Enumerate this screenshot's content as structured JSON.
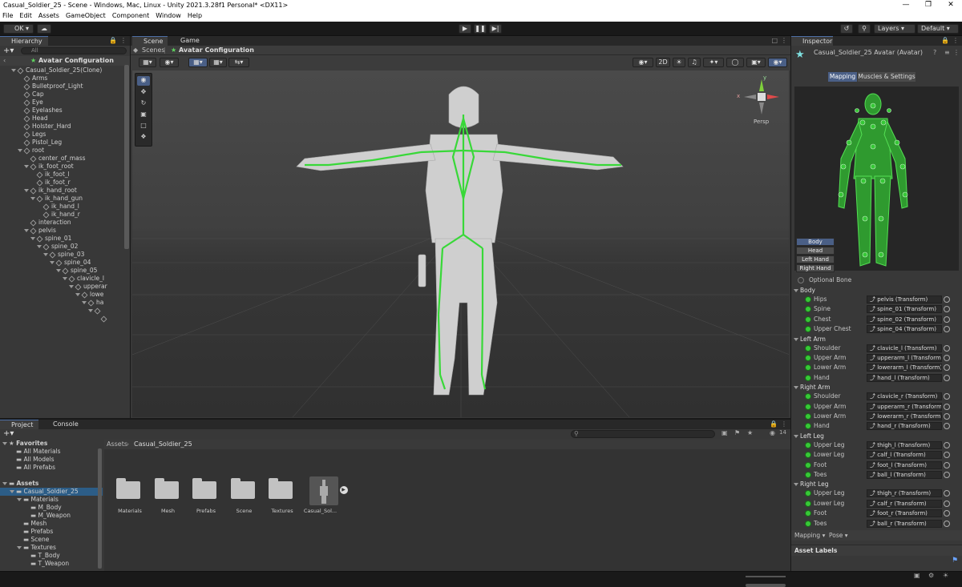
{
  "window": {
    "title": "Casual_Soldier_25 - Scene - Windows, Mac, Linux - Unity 2021.3.28f1 Personal* <DX11>"
  },
  "menu": [
    "File",
    "Edit",
    "Assets",
    "GameObject",
    "Component",
    "Window",
    "Help"
  ],
  "toolbar": {
    "account": "OK",
    "layers": "Layers",
    "layout": "Default"
  },
  "hierarchy": {
    "tab": "Hierarchy",
    "search_placeholder": "All",
    "header": "Avatar Configuration",
    "items": [
      {
        "label": "Casual_Soldier_25(Clone)",
        "depth": 1,
        "exp": true
      },
      {
        "label": "Arms",
        "depth": 2
      },
      {
        "label": "Bulletproof_Light",
        "depth": 2
      },
      {
        "label": "Cap",
        "depth": 2
      },
      {
        "label": "Eye",
        "depth": 2
      },
      {
        "label": "Eyelashes",
        "depth": 2
      },
      {
        "label": "Head",
        "depth": 2
      },
      {
        "label": "Holster_Hard",
        "depth": 2
      },
      {
        "label": "Legs",
        "depth": 2
      },
      {
        "label": "Pistol_Leg",
        "depth": 2
      },
      {
        "label": "root",
        "depth": 2,
        "exp": true
      },
      {
        "label": "center_of_mass",
        "depth": 3
      },
      {
        "label": "ik_foot_root",
        "depth": 3,
        "exp": true
      },
      {
        "label": "ik_foot_l",
        "depth": 4
      },
      {
        "label": "ik_foot_r",
        "depth": 4
      },
      {
        "label": "ik_hand_root",
        "depth": 3,
        "exp": true
      },
      {
        "label": "ik_hand_gun",
        "depth": 4,
        "exp": true
      },
      {
        "label": "ik_hand_l",
        "depth": 5
      },
      {
        "label": "ik_hand_r",
        "depth": 5
      },
      {
        "label": "interaction",
        "depth": 3
      },
      {
        "label": "pelvis",
        "depth": 3,
        "exp": true
      },
      {
        "label": "spine_01",
        "depth": 4,
        "exp": true
      },
      {
        "label": "spine_02",
        "depth": 5,
        "exp": true
      },
      {
        "label": "spine_03",
        "depth": 6,
        "exp": true
      },
      {
        "label": "spine_04",
        "depth": 7,
        "exp": true
      },
      {
        "label": "spine_05",
        "depth": 8,
        "exp": true
      },
      {
        "label": "clavicle_l",
        "depth": 9,
        "exp": true
      },
      {
        "label": "upperar",
        "depth": 10,
        "exp": true
      },
      {
        "label": "lowe",
        "depth": 11,
        "exp": true
      },
      {
        "label": "ha",
        "depth": 12,
        "exp": true
      },
      {
        "label": "",
        "depth": 13,
        "exp": true
      },
      {
        "label": "",
        "depth": 14
      }
    ]
  },
  "scene": {
    "tabs": [
      "Scene",
      "Game"
    ],
    "breadcrumb": [
      "Scenes",
      "Avatar Configuration"
    ],
    "mode_2d": "2D",
    "persp": "Persp",
    "axis_y": "y",
    "axis_x": "x"
  },
  "inspector": {
    "tab": "Inspector",
    "title": "Casual_Soldier_25 Avatar (Avatar)",
    "subtabs": [
      "Mapping",
      "Muscles & Settings"
    ],
    "body_buttons": [
      "Body",
      "Head",
      "Left Hand",
      "Right Hand"
    ],
    "optional_bone": "Optional Bone",
    "groups": [
      {
        "name": "Body",
        "rows": [
          [
            "Hips",
            "pelvis (Transform)"
          ],
          [
            "Spine",
            "spine_01 (Transform)"
          ],
          [
            "Chest",
            "spine_02 (Transform)"
          ],
          [
            "Upper Chest",
            "spine_04 (Transform)"
          ]
        ]
      },
      {
        "name": "Left Arm",
        "rows": [
          [
            "Shoulder",
            "clavicle_l (Transform)"
          ],
          [
            "Upper Arm",
            "upperarm_l (Transform)"
          ],
          [
            "Lower Arm",
            "lowerarm_l (Transform)"
          ],
          [
            "Hand",
            "hand_l (Transform)"
          ]
        ]
      },
      {
        "name": "Right Arm",
        "rows": [
          [
            "Shoulder",
            "clavicle_r (Transform)"
          ],
          [
            "Upper Arm",
            "upperarm_r (Transform)"
          ],
          [
            "Lower Arm",
            "lowerarm_r (Transform)"
          ],
          [
            "Hand",
            "hand_r (Transform)"
          ]
        ]
      },
      {
        "name": "Left Leg",
        "rows": [
          [
            "Upper Leg",
            "thigh_l (Transform)"
          ],
          [
            "Lower Leg",
            "calf_l (Transform)"
          ],
          [
            "Foot",
            "foot_l (Transform)"
          ],
          [
            "Toes",
            "ball_l (Transform)"
          ]
        ]
      },
      {
        "name": "Right Leg",
        "rows": [
          [
            "Upper Leg",
            "thigh_r (Transform)"
          ],
          [
            "Lower Leg",
            "calf_r (Transform)"
          ],
          [
            "Foot",
            "foot_r (Transform)"
          ],
          [
            "Toes",
            "ball_r (Transform)"
          ]
        ]
      }
    ],
    "footer": {
      "mapping": "Mapping",
      "pose": "Pose"
    },
    "asset_labels": "Asset Labels"
  },
  "project": {
    "tabs": [
      "Project",
      "Console"
    ],
    "breadcrumb": [
      "Assets",
      "Casual_Soldier_25"
    ],
    "count": "14",
    "tree": [
      {
        "label": "Favorites",
        "depth": 0,
        "exp": true,
        "star": true
      },
      {
        "label": "All Materials",
        "depth": 1
      },
      {
        "label": "All Models",
        "depth": 1
      },
      {
        "label": "All Prefabs",
        "depth": 1
      },
      {
        "label": "",
        "depth": 0
      },
      {
        "label": "Assets",
        "depth": 0,
        "exp": true
      },
      {
        "label": "Casual_Soldier_25",
        "depth": 1,
        "exp": true,
        "sel": true
      },
      {
        "label": "Materials",
        "depth": 2,
        "exp": true
      },
      {
        "label": "M_Body",
        "depth": 3
      },
      {
        "label": "M_Weapon",
        "depth": 3
      },
      {
        "label": "Mesh",
        "depth": 2
      },
      {
        "label": "Prefabs",
        "depth": 2
      },
      {
        "label": "Scene",
        "depth": 2
      },
      {
        "label": "Textures",
        "depth": 2,
        "exp": true
      },
      {
        "label": "T_Body",
        "depth": 3
      },
      {
        "label": "T_Weapon",
        "depth": 3
      }
    ],
    "assets": [
      "Materials",
      "Mesh",
      "Prefabs",
      "Scene",
      "Textures",
      "Casual_Sol..."
    ]
  }
}
